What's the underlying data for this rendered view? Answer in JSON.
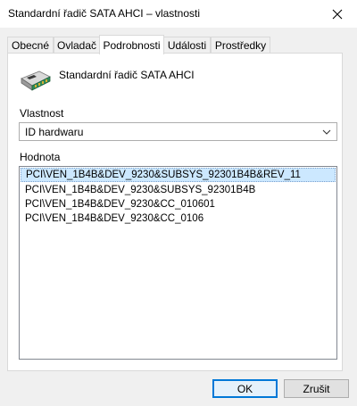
{
  "window": {
    "title": "Standardní řadič  SATA AHCI – vlastnosti"
  },
  "tabs": [
    {
      "label": "Obecné"
    },
    {
      "label": "Ovladač"
    },
    {
      "label": "Podrobnosti"
    },
    {
      "label": "Události"
    },
    {
      "label": "Prostředky"
    }
  ],
  "active_tab": "Podrobnosti",
  "device": {
    "name": "Standardní řadič  SATA AHCI",
    "icon": "storage-controller-icon"
  },
  "property": {
    "label": "Vlastnost",
    "selected": "ID hardwaru"
  },
  "value": {
    "label": "Hodnota",
    "items": [
      "PCI\\VEN_1B4B&DEV_9230&SUBSYS_92301B4B&REV_11",
      "PCI\\VEN_1B4B&DEV_9230&SUBSYS_92301B4B",
      "PCI\\VEN_1B4B&DEV_9230&CC_010601",
      "PCI\\VEN_1B4B&DEV_9230&CC_0106"
    ],
    "selected_index": 0
  },
  "buttons": {
    "ok": "OK",
    "cancel": "Zrušit"
  },
  "colors": {
    "selection": "#cce8ff",
    "default_button_border": "#0078d7",
    "dialog_background": "#f0f0f0"
  }
}
